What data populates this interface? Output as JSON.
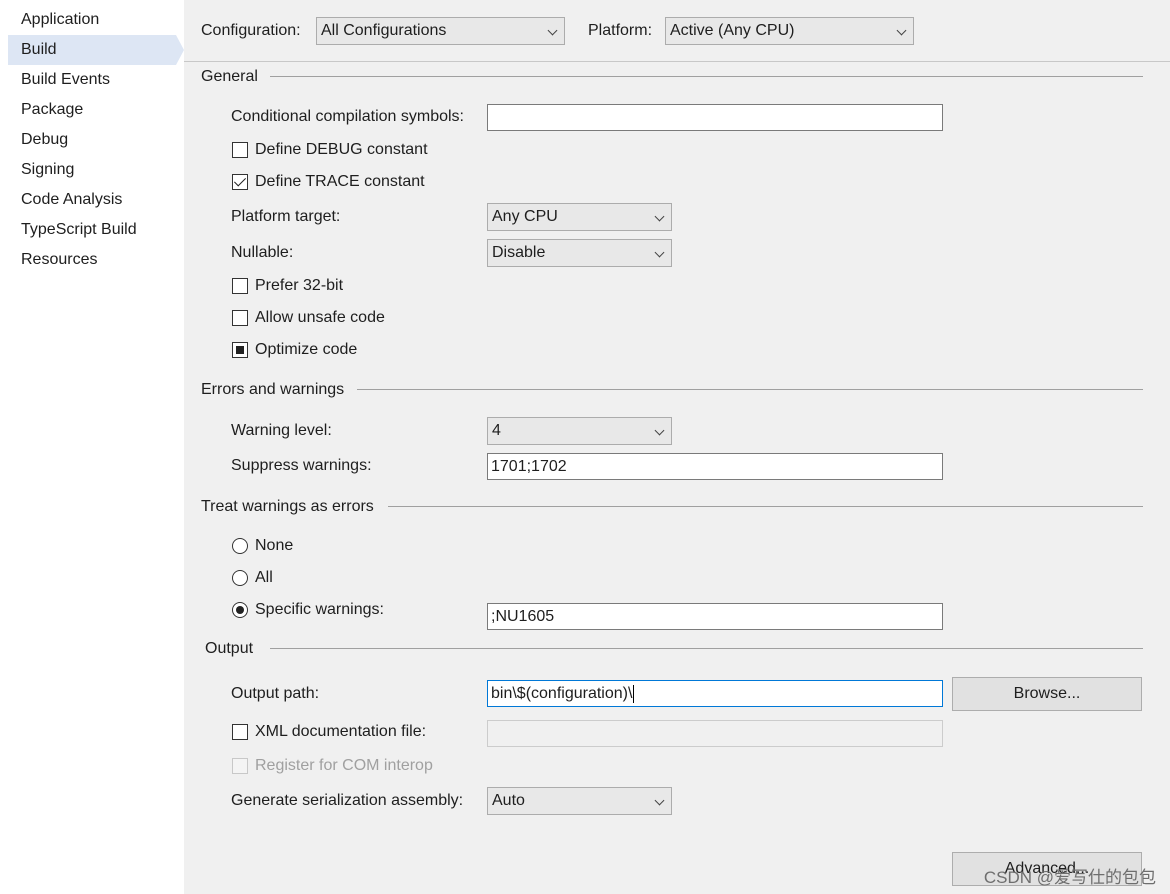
{
  "sidebar": {
    "items": [
      {
        "label": "Application"
      },
      {
        "label": "Build",
        "selected": true
      },
      {
        "label": "Build Events"
      },
      {
        "label": "Package"
      },
      {
        "label": "Debug"
      },
      {
        "label": "Signing"
      },
      {
        "label": "Code Analysis"
      },
      {
        "label": "TypeScript Build"
      },
      {
        "label": "Resources"
      }
    ]
  },
  "header": {
    "configuration_label": "Configuration:",
    "configuration_value": "All Configurations",
    "platform_label": "Platform:",
    "platform_value": "Active (Any CPU)"
  },
  "general": {
    "title": "General",
    "conditional_symbols_label": "Conditional compilation symbols:",
    "conditional_symbols_value": "",
    "define_debug_label": "Define DEBUG constant",
    "define_debug_checked": false,
    "define_trace_label": "Define TRACE constant",
    "define_trace_checked": true,
    "platform_target_label": "Platform target:",
    "platform_target_value": "Any CPU",
    "nullable_label": "Nullable:",
    "nullable_value": "Disable",
    "prefer32_label": "Prefer 32-bit",
    "prefer32_checked": false,
    "unsafe_label": "Allow unsafe code",
    "unsafe_checked": false,
    "optimize_label": "Optimize code",
    "optimize_state": "indeterminate"
  },
  "errors": {
    "title": "Errors and warnings",
    "warning_level_label": "Warning level:",
    "warning_level_value": "4",
    "suppress_label": "Suppress warnings:",
    "suppress_value": "1701;1702"
  },
  "treat": {
    "title": "Treat warnings as errors",
    "none_label": "None",
    "all_label": "All",
    "specific_label": "Specific warnings:",
    "selected": "specific",
    "specific_value": ";NU1605"
  },
  "output": {
    "title": "Output",
    "path_label": "Output path:",
    "path_value": "bin\\$(configuration)\\",
    "browse_label": "Browse...",
    "xml_doc_label": "XML documentation file:",
    "xml_doc_checked": false,
    "xml_doc_value": "",
    "com_interop_label": "Register for COM interop",
    "com_interop_enabled": false,
    "serialization_label": "Generate serialization assembly:",
    "serialization_value": "Auto",
    "advanced_label": "Advanced..."
  },
  "watermark": "CSDN @爱写仕的包包",
  "colors": {
    "selected_item_bg": "#dde6f4",
    "panel_bg": "#f0f0f0",
    "sidebar_bg": "#ffffff",
    "focus_border": "#0078d7"
  }
}
